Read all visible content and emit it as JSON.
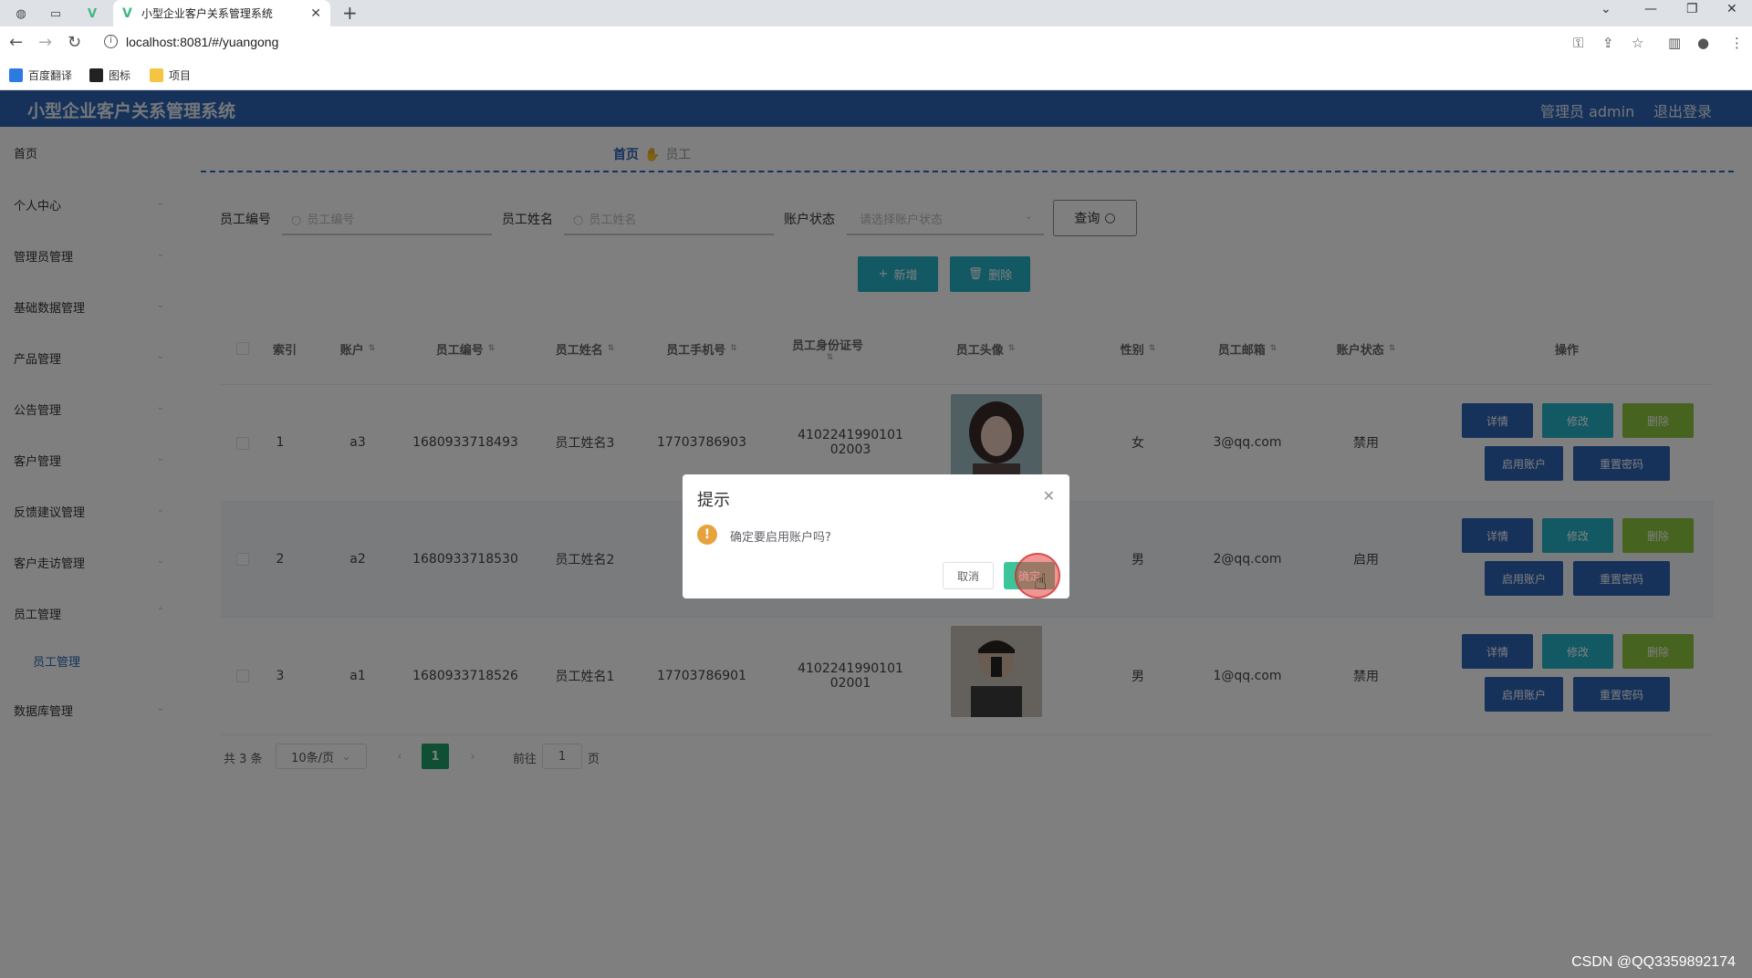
{
  "browser": {
    "tab_title": "小型企业客户关系管理系统",
    "url": "localhost:8081/#/yuangong",
    "bookmarks": [
      "百度翻译",
      "图标",
      "项目"
    ]
  },
  "app": {
    "title": "小型企业客户关系管理系统",
    "user_label": "管理员 admin",
    "logout_label": "退出登录"
  },
  "sidebar": {
    "items": [
      "首页",
      "个人中心",
      "管理员管理",
      "基础数据管理",
      "产品管理",
      "公告管理",
      "客户管理",
      "反馈建议管理",
      "客户走访管理",
      "员工管理",
      "数据库管理"
    ],
    "sub_item": "员工管理"
  },
  "breadcrumb": {
    "home": "首页",
    "current": "员工"
  },
  "filters": {
    "code_label": "员工编号",
    "code_placeholder": "员工编号",
    "name_label": "员工姓名",
    "name_placeholder": "员工姓名",
    "status_label": "账户状态",
    "status_placeholder": "请选择账户状态",
    "query_label": "查询"
  },
  "actions": {
    "add_label": "新增",
    "delete_label": "删除"
  },
  "table": {
    "headers": [
      "索引",
      "账户",
      "员工编号",
      "员工姓名",
      "员工手机号",
      "员工身份证号",
      "员工头像",
      "性别",
      "员工邮箱",
      "账户状态",
      "操作"
    ],
    "rows": [
      {
        "index": "1",
        "account": "a3",
        "code": "1680933718493",
        "name": "员工姓名3",
        "phone": "17703786903",
        "idcard1": "4102241990101",
        "idcard2": "02003",
        "gender": "女",
        "email": "3@qq.com",
        "status": "禁用"
      },
      {
        "index": "2",
        "account": "a2",
        "code": "1680933718530",
        "name": "员工姓名2",
        "phone": "",
        "idcard1": "",
        "idcard2": "",
        "gender": "男",
        "email": "2@qq.com",
        "status": "启用"
      },
      {
        "index": "3",
        "account": "a1",
        "code": "1680933718526",
        "name": "员工姓名1",
        "phone": "17703786901",
        "idcard1": "4102241990101",
        "idcard2": "02001",
        "gender": "男",
        "email": "1@qq.com",
        "status": "禁用"
      }
    ],
    "row_buttons": {
      "detail": "详情",
      "edit": "修改",
      "delete": "删除",
      "enable": "启用账户",
      "reset": "重置密码"
    }
  },
  "pagination": {
    "total": "共 3 条",
    "page_size": "10条/页",
    "current": "1",
    "goto_label": "前往",
    "goto_value": "1",
    "page_suffix": "页"
  },
  "dialog": {
    "title": "提示",
    "message": "确定要启用账户吗?",
    "cancel_label": "取消",
    "confirm_label": "确定"
  },
  "watermark": "CSDN @QQ3359892174",
  "colors": {
    "header": "#2c64b4",
    "teal": "#25b3c9",
    "green": "#8dc63f",
    "pager_active": "#1fa06a",
    "confirm": "#3cc59a"
  }
}
